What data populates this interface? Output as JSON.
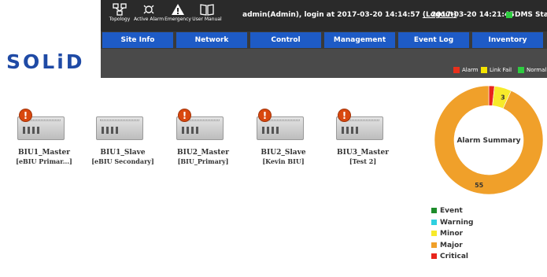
{
  "logo": "SOLiD",
  "toolbar": {
    "items": [
      {
        "label": "Topology",
        "icon": "topology-icon"
      },
      {
        "label": "Active Alarm",
        "icon": "active-alarm-icon"
      },
      {
        "label": "Emergency",
        "icon": "emergency-icon"
      },
      {
        "label": "User Manual",
        "icon": "user-manual-icon"
      }
    ],
    "login_prefix": "admin(Admin), login at 2017-03-20 14:14:57",
    "logout_label": "(Logout)",
    "clock": "2017-03-20 14:21:45",
    "dms_label": "DMS Status",
    "dms_color": "#2ecc40"
  },
  "menu": [
    "Site Info",
    "Network",
    "Control",
    "Management",
    "Event Log",
    "Inventory"
  ],
  "status_legend": [
    {
      "label": "Alarm",
      "color": "#e8301c"
    },
    {
      "label": "Link Fail",
      "color": "#f5e400"
    },
    {
      "label": "Normal",
      "color": "#2ecc40"
    }
  ],
  "devices": [
    {
      "name": "BIU1_Master",
      "sub": "[eBIU Primar...]",
      "alarm": true,
      "warn_symbol": "!"
    },
    {
      "name": "BIU1_Slave",
      "sub": "[eBIU Secondary]",
      "alarm": false
    },
    {
      "name": "BIU2_Master",
      "sub": "[BIU_Primary]",
      "alarm": true,
      "warn_symbol": "!"
    },
    {
      "name": "BIU2_Slave",
      "sub": "[Kevin BIU]",
      "alarm": true,
      "warn_symbol": "!"
    },
    {
      "name": "BIU3_Master",
      "sub": "[Test 2]",
      "alarm": true,
      "warn_symbol": "!"
    }
  ],
  "alarm_summary": {
    "title": "Alarm Summary",
    "slices": [
      {
        "label": "Critical",
        "value": 1,
        "color": "#e8251c",
        "shown": ""
      },
      {
        "label": "Minor",
        "value": 3,
        "color": "#f7ea2a",
        "shown": "3"
      },
      {
        "label": "Major",
        "value": 55,
        "color": "#f0a02a",
        "shown": "55"
      }
    ],
    "legend": [
      {
        "label": "Event",
        "color": "#1d8c2a"
      },
      {
        "label": "Warning",
        "color": "#2fd0e0"
      },
      {
        "label": "Minor",
        "color": "#f7ea2a"
      },
      {
        "label": "Major",
        "color": "#f0a02a"
      },
      {
        "label": "Critical",
        "color": "#e8251c"
      }
    ]
  }
}
